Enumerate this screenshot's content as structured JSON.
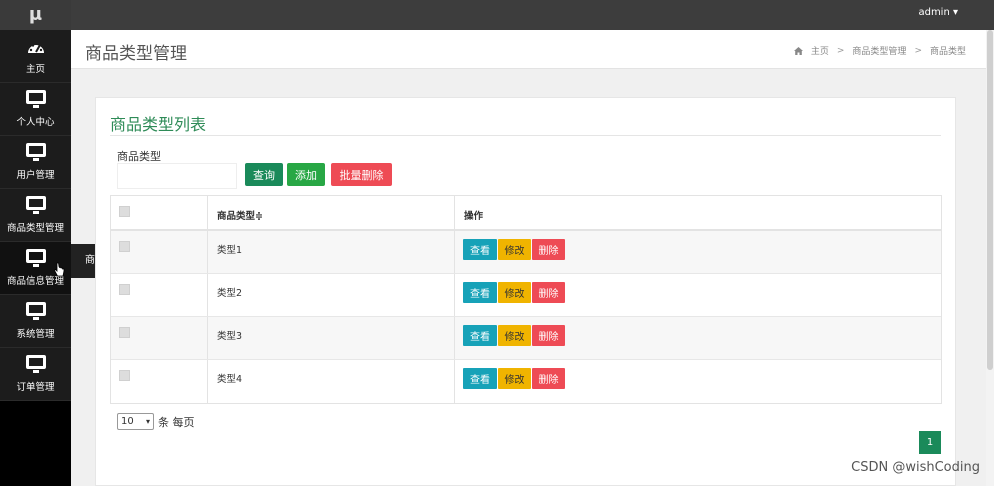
{
  "brand": {
    "logo": "μ"
  },
  "topbar": {
    "user": "admin ▾"
  },
  "sidebar": {
    "items": [
      {
        "label": "主页",
        "icon": "dashboard-icon"
      },
      {
        "label": "个人中心",
        "icon": "monitor-icon"
      },
      {
        "label": "用户管理",
        "icon": "monitor-icon"
      },
      {
        "label": "商品类型管理",
        "icon": "monitor-icon"
      },
      {
        "label": "商品信息管理",
        "icon": "monitor-icon"
      },
      {
        "label": "系统管理",
        "icon": "monitor-icon"
      },
      {
        "label": "订单管理",
        "icon": "monitor-icon"
      }
    ],
    "flyout": {
      "label": "商品信息"
    }
  },
  "header": {
    "title": "商品类型管理",
    "breadcrumb": {
      "home": "主页",
      "level1": "商品类型管理",
      "level2": "商品类型",
      "sep": ">"
    }
  },
  "panel": {
    "title": "商品类型列表",
    "filter": {
      "label": "商品类型",
      "value": ""
    },
    "buttons": {
      "query": "查询",
      "add": "添加",
      "batch_delete": "批量删除"
    },
    "table": {
      "headers": {
        "name": "商品类型≑",
        "actions": "操作"
      },
      "rows": [
        {
          "name": "类型1"
        },
        {
          "name": "类型2"
        },
        {
          "name": "类型3"
        },
        {
          "name": "类型4"
        }
      ],
      "row_actions": {
        "view": "查看",
        "edit": "修改",
        "delete": "删除"
      }
    },
    "page_size": {
      "value": "10",
      "suffix": "条 每页"
    },
    "pager": {
      "current": "1"
    }
  },
  "watermark": "CSDN @wishCoding",
  "colors": {
    "accent": "#1a8a5a",
    "add": "#28a745",
    "danger": "#ee4b55",
    "info": "#17a2b8",
    "warning": "#f0b400"
  }
}
